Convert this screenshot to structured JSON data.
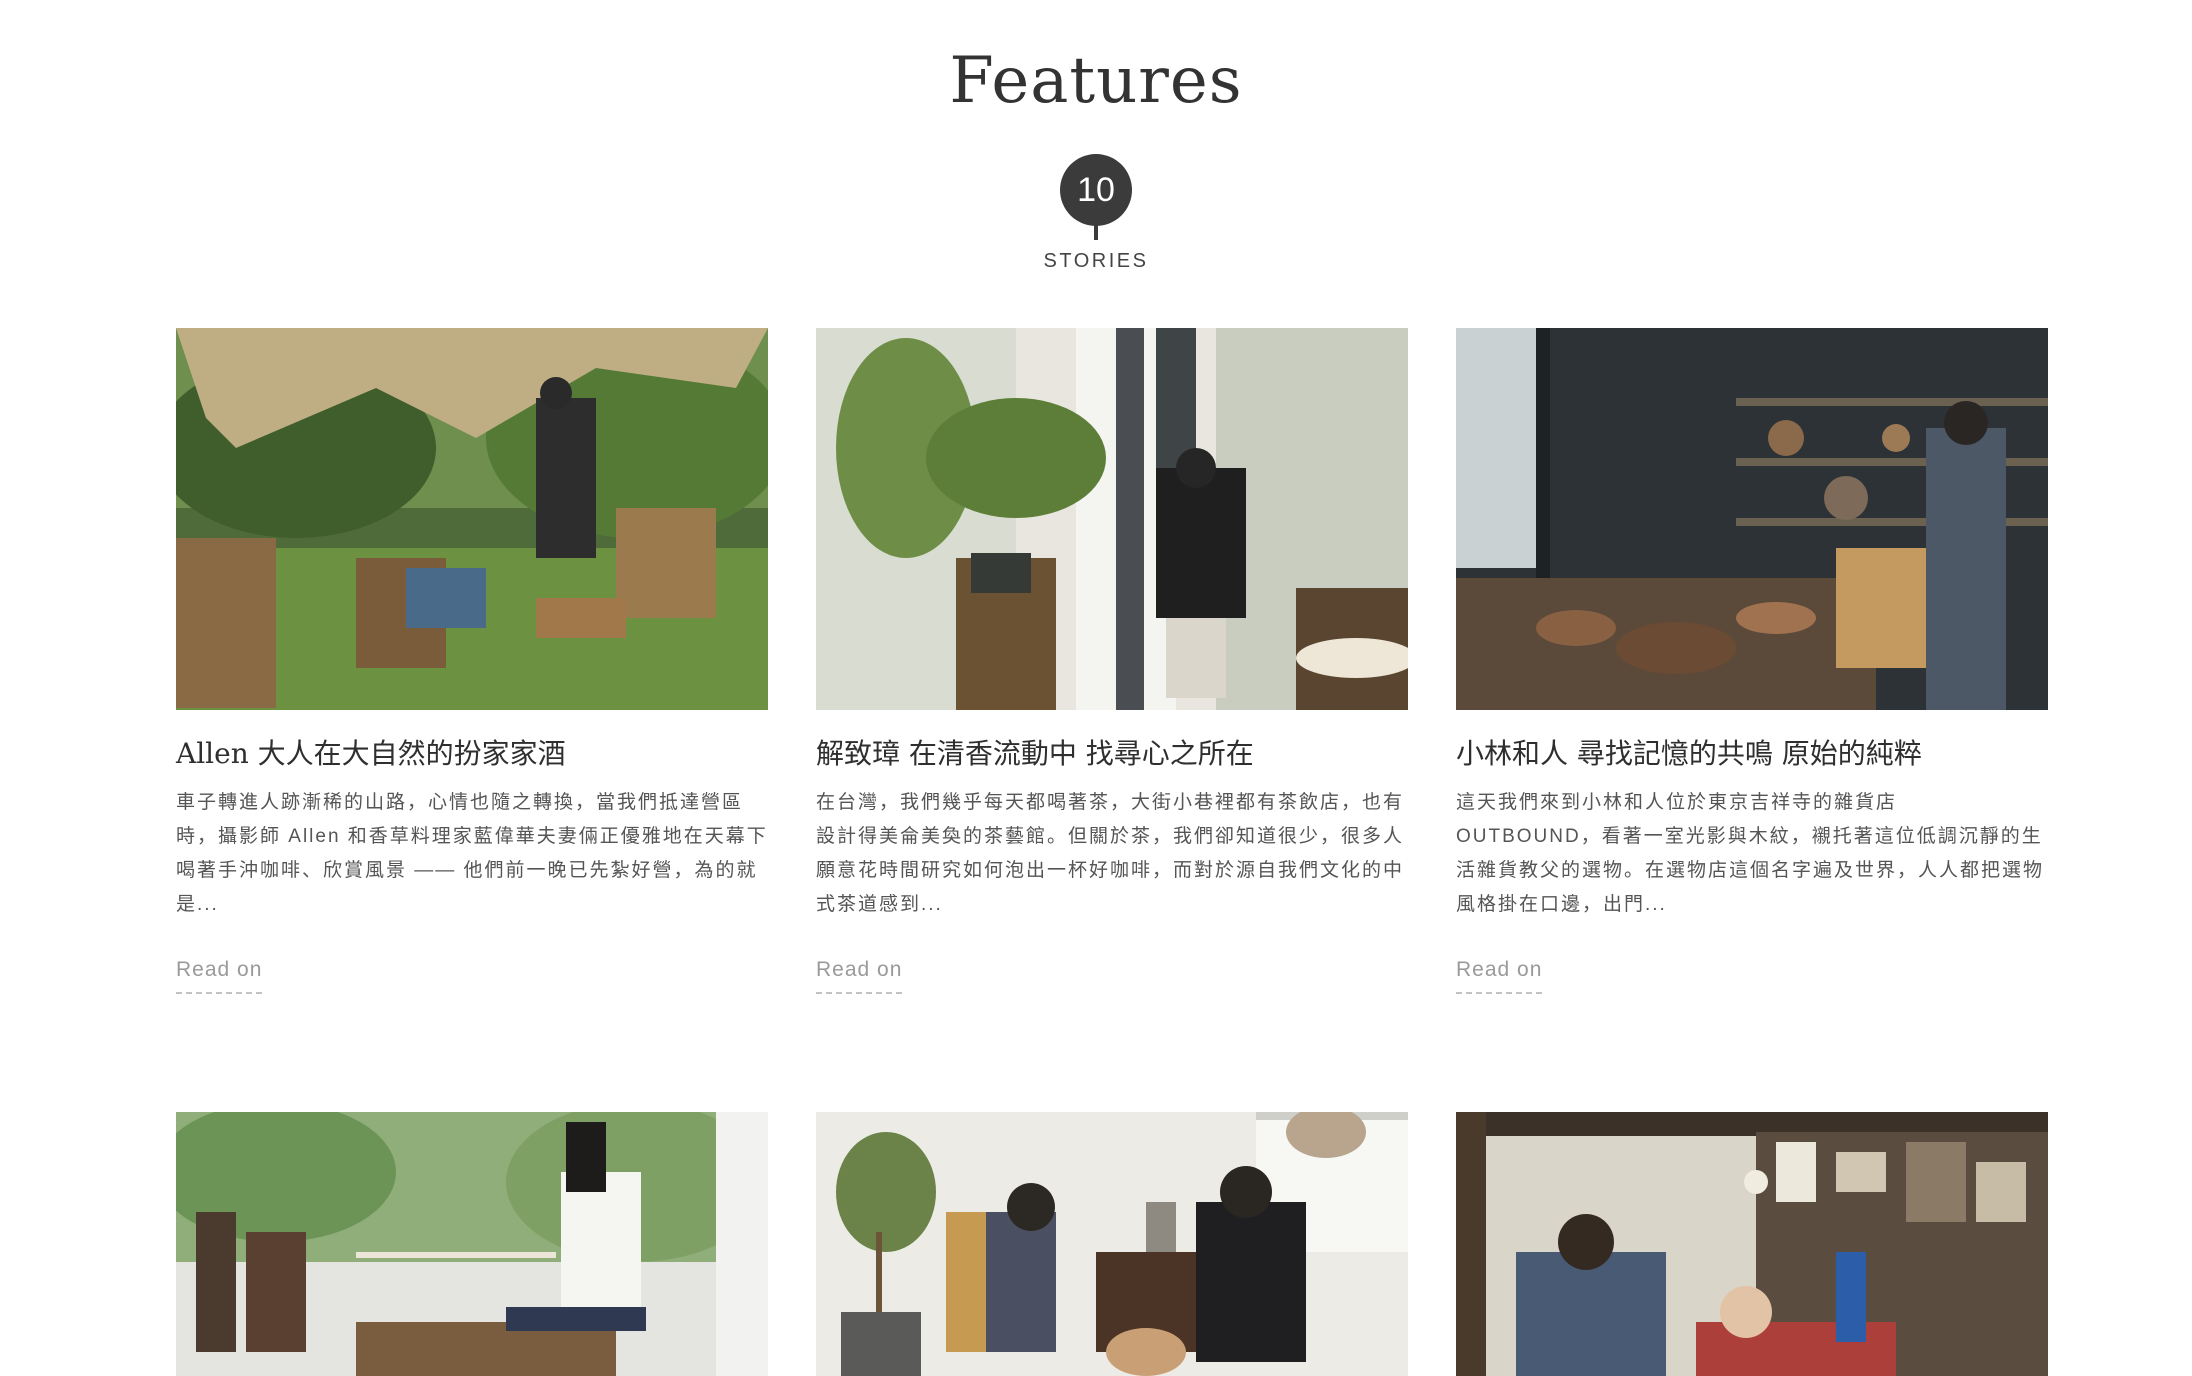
{
  "header": {
    "title": "Features",
    "count": "10",
    "count_label": "STORIES"
  },
  "cards": [
    {
      "title": "Allen 大人在大自然的扮家家酒",
      "excerpt": "車子轉進人跡漸稀的山路，心情也隨之轉換，當我們抵達營區時，攝影師 Allen 和香草料理家藍偉華夫妻倆正優雅地在天幕下喝著手沖咖啡、欣賞風景 —— 他們前一晚已先紮好營，為的就是...",
      "read_on": "Read on",
      "image_icon": "outdoor-camping-photo"
    },
    {
      "title": "解致璋 在清香流動中 找尋心之所在",
      "excerpt": "在台灣，我們幾乎每天都喝著茶，大街小巷裡都有茶飲店，也有設計得美侖美奐的茶藝館。但關於茶，我們卻知道很少，很多人願意花時間研究如何泡出一杯好咖啡，而對於源自我們文化的中式茶道感到...",
      "read_on": "Read on",
      "image_icon": "tea-house-photo"
    },
    {
      "title": "小林和人 尋找記憶的共鳴 原始的純粹",
      "excerpt": "這天我們來到小林和人位於東京吉祥寺的雜貨店 OUTBOUND，看著一室光影與木紋，襯托著這位低調沉靜的生活雜貨教父的選物。在選物店這個名字遍及世界，人人都把選物風格掛在口邊，出門...",
      "read_on": "Read on",
      "image_icon": "craft-shop-photo"
    },
    {
      "title": "",
      "excerpt": "",
      "read_on": "",
      "image_icon": "studio-woman-photo"
    },
    {
      "title": "",
      "excerpt": "",
      "read_on": "",
      "image_icon": "living-room-couple-photo"
    },
    {
      "title": "",
      "excerpt": "",
      "read_on": "",
      "image_icon": "workshop-men-photo"
    }
  ]
}
